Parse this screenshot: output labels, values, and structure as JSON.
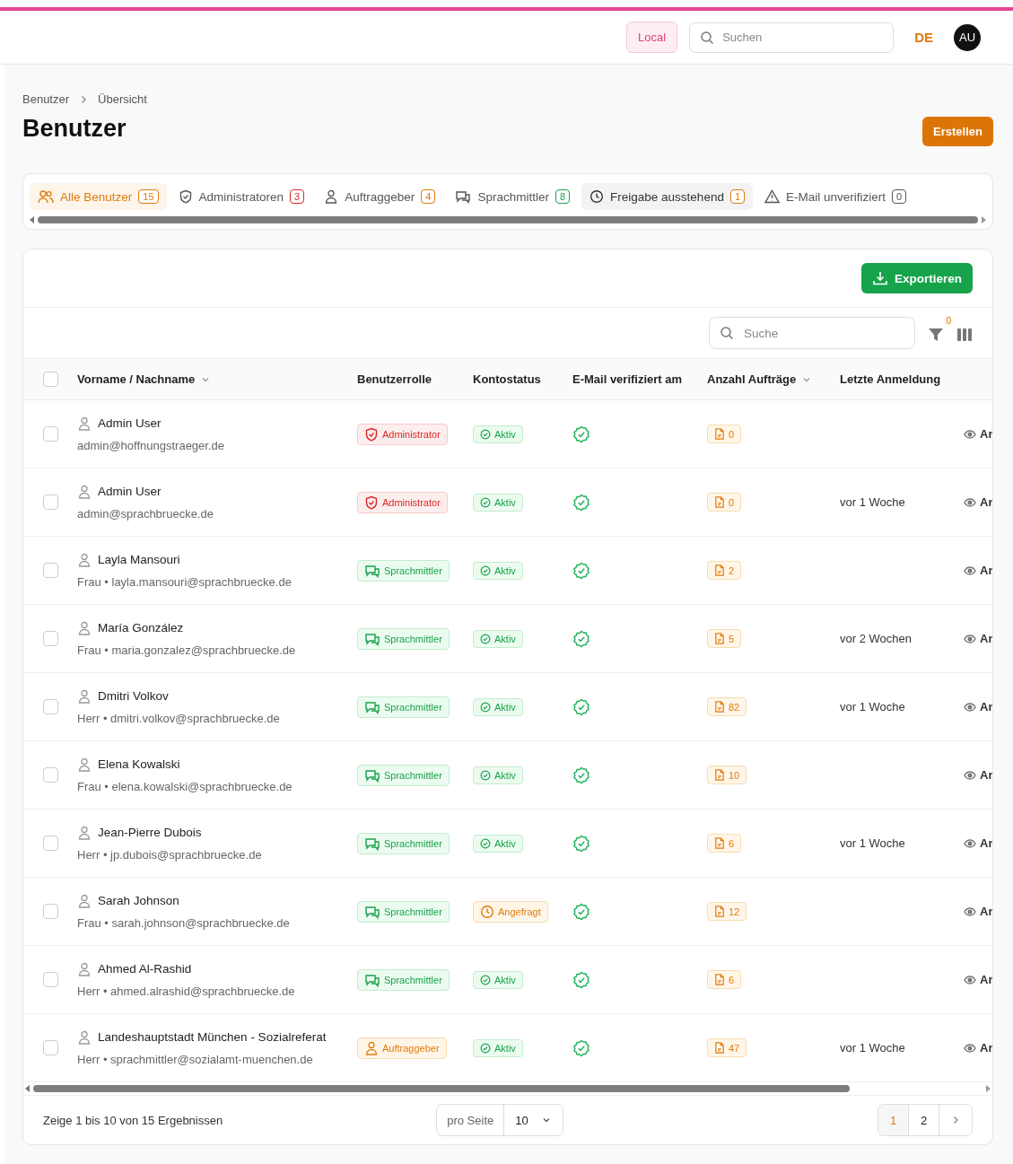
{
  "topbar": {
    "environment": "Local",
    "search": {
      "placeholder": "Suchen"
    },
    "language": {
      "label": "DE",
      "active": true
    },
    "avatar": "AU"
  },
  "breadcrumb": [
    "Benutzer",
    "Übersicht"
  ],
  "title": "Benutzer",
  "create_button": "Erstellen",
  "tabs": [
    {
      "label": "Alle Benutzer",
      "count": "15",
      "color": "#e07b0e",
      "selected": true,
      "hovered": false
    },
    {
      "label": "Administratoren",
      "count": "3",
      "color": "#dc2626",
      "selected": false,
      "hovered": false
    },
    {
      "label": "Auftraggeber",
      "count": "4",
      "color": "#e07b0e",
      "selected": false,
      "hovered": false
    },
    {
      "label": "Sprachmittler",
      "count": "8",
      "color": "#16a34a",
      "selected": false,
      "hovered": false
    },
    {
      "label": "Freigabe ausstehend",
      "count": "1",
      "color": "#e07b0e",
      "selected": false,
      "hovered": true
    },
    {
      "label": "E-Mail unverifiziert",
      "count": "0",
      "color": "#555555",
      "selected": false,
      "hovered": false
    }
  ],
  "export_button": "Exportieren",
  "table_search": {
    "placeholder": "Suche"
  },
  "filter_count": "0",
  "select_all_checked": false,
  "columns": [
    {
      "label": "Vorname / Nachname",
      "sortable": true
    },
    {
      "label": "Benutzerrolle",
      "sortable": false
    },
    {
      "label": "Kontostatus",
      "sortable": false
    },
    {
      "label": "E-Mail verifiziert am",
      "sortable": false
    },
    {
      "label": "Anzahl Aufträge",
      "sortable": true
    },
    {
      "label": "Letzte Anmeldung",
      "sortable": false
    }
  ],
  "rows": [
    {
      "checked": false,
      "name": "Admin User",
      "detail": "admin@hoffnungstraeger.de",
      "role": {
        "kind": "admin",
        "label": "Administrator"
      },
      "status": {
        "kind": "active",
        "label": "Aktiv"
      },
      "verified": true,
      "orders": "0",
      "action": "Ar"
    },
    {
      "checked": false,
      "name": "Admin User",
      "detail": "admin@sprachbruecke.de",
      "role": {
        "kind": "admin",
        "label": "Administrator"
      },
      "status": {
        "kind": "active",
        "label": "Aktiv"
      },
      "verified": true,
      "orders": "0",
      "last_login": "vor 1 Woche",
      "action": "Ar"
    },
    {
      "checked": false,
      "name": "Layla Mansouri",
      "detail": "Frau • layla.mansouri@sprachbruecke.de",
      "role": {
        "kind": "translator",
        "label": "Sprachmittler"
      },
      "status": {
        "kind": "active",
        "label": "Aktiv"
      },
      "verified": true,
      "orders": "2",
      "action": "Ar"
    },
    {
      "checked": false,
      "name": "María González",
      "detail": "Frau • maria.gonzalez@sprachbruecke.de",
      "role": {
        "kind": "translator",
        "label": "Sprachmittler"
      },
      "status": {
        "kind": "active",
        "label": "Aktiv"
      },
      "verified": true,
      "orders": "5",
      "last_login": "vor 2 Wochen",
      "action": "Ar"
    },
    {
      "checked": false,
      "name": "Dmitri Volkov",
      "detail": "Herr • dmitri.volkov@sprachbruecke.de",
      "role": {
        "kind": "translator",
        "label": "Sprachmittler"
      },
      "status": {
        "kind": "active",
        "label": "Aktiv"
      },
      "verified": true,
      "orders": "82",
      "last_login": "vor 1 Woche",
      "action": "Ar"
    },
    {
      "checked": false,
      "name": "Elena Kowalski",
      "detail": "Frau • elena.kowalski@sprachbruecke.de",
      "role": {
        "kind": "translator",
        "label": "Sprachmittler"
      },
      "status": {
        "kind": "active",
        "label": "Aktiv"
      },
      "verified": true,
      "orders": "10",
      "action": "Ar"
    },
    {
      "checked": false,
      "name": "Jean-Pierre Dubois",
      "detail": "Herr • jp.dubois@sprachbruecke.de",
      "role": {
        "kind": "translator",
        "label": "Sprachmittler"
      },
      "status": {
        "kind": "active",
        "label": "Aktiv"
      },
      "verified": true,
      "orders": "6",
      "last_login": "vor 1 Woche",
      "action": "Ar"
    },
    {
      "checked": false,
      "name": "Sarah Johnson",
      "detail": "Frau • sarah.johnson@sprachbruecke.de",
      "role": {
        "kind": "translator",
        "label": "Sprachmittler"
      },
      "status": {
        "kind": "requested",
        "label": "Angefragt"
      },
      "verified": true,
      "orders": "12",
      "action": "Ar"
    },
    {
      "checked": false,
      "name": "Ahmed Al-Rashid",
      "detail": "Herr • ahmed.alrashid@sprachbruecke.de",
      "role": {
        "kind": "translator",
        "label": "Sprachmittler"
      },
      "status": {
        "kind": "active",
        "label": "Aktiv"
      },
      "verified": true,
      "orders": "6",
      "action": "Ar"
    },
    {
      "checked": false,
      "name": "Landeshauptstadt München - Sozialreferat",
      "detail": "Herr • sprachmittler@sozialamt-muenchen.de",
      "role": {
        "kind": "client",
        "label": "Auftraggeber"
      },
      "status": {
        "kind": "active",
        "label": "Aktiv"
      },
      "verified": true,
      "orders": "47",
      "last_login": "vor 1 Woche",
      "action": "Ar"
    }
  ],
  "footer": {
    "summary": "Zeige 1 bis 10 von 15 Ergebnissen",
    "per_page_label": "pro Seite",
    "per_page": "10",
    "pages": [
      {
        "label": "1",
        "selected": true
      },
      {
        "label": "2",
        "selected": false
      }
    ]
  }
}
